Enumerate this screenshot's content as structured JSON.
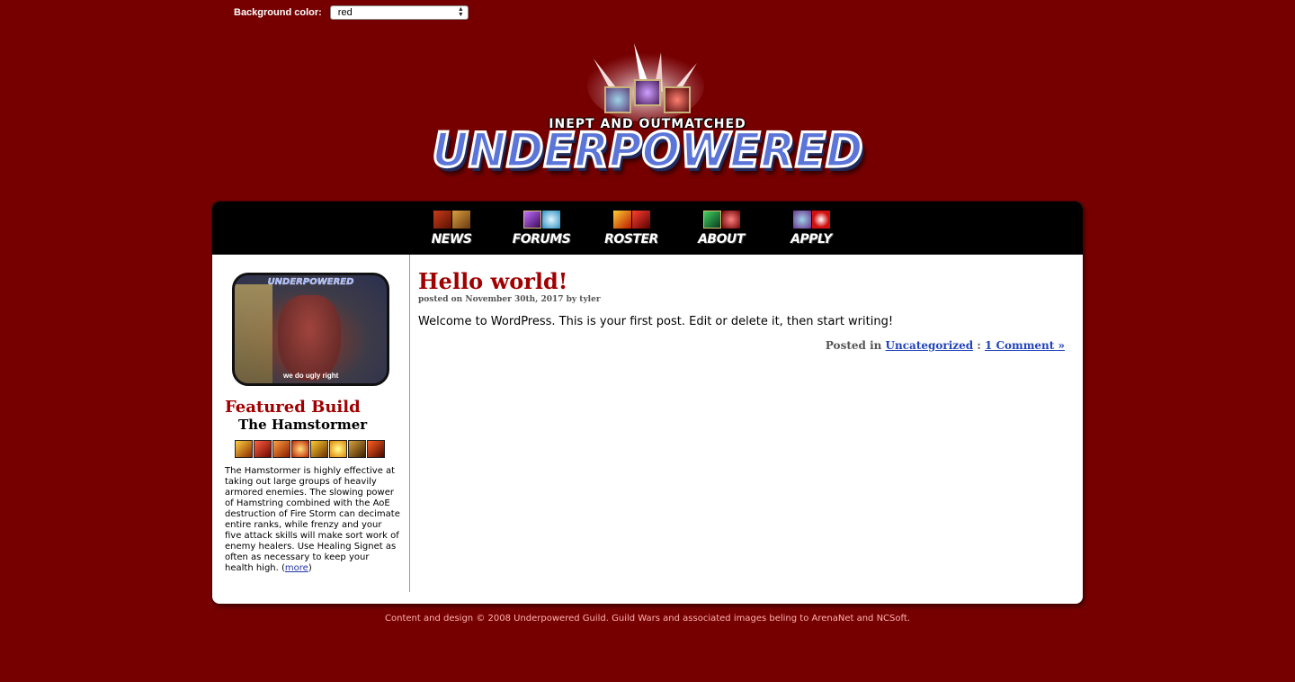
{
  "background_selector": {
    "label": "Background color:",
    "value": "red"
  },
  "logo": {
    "tagline": "INEPT AND OUTMATCHED",
    "wordmark": "UNDERPOWERED"
  },
  "nav": [
    {
      "label": "NEWS"
    },
    {
      "label": "FORUMS"
    },
    {
      "label": "ROSTER"
    },
    {
      "label": "ABOUT"
    },
    {
      "label": "APPLY"
    }
  ],
  "sidebar": {
    "portrait_brand": "UNDERPOWERED",
    "portrait_caption": "we do ugly right",
    "featured_title": "Featured Build",
    "build_name": "The Hamstormer",
    "description": "The Hamstormer is highly effective at taking out large groups of heavily armored enemies. The slowing power of Hamstring combined with the AoE destruction of Fire Storm can decimate entire ranks, while frenzy and your five attack skills will make sort work of enemy healers. Use Healing Signet as often as necessary to keep your health high.",
    "more_label": "more"
  },
  "post": {
    "title": "Hello world!",
    "meta": "posted on November 30th, 2017 by tyler",
    "body": "Welcome to WordPress. This is your first post. Edit or delete it, then start writing!",
    "posted_in_label": "Posted in",
    "category": "Uncategorized",
    "separator": ":",
    "comments": "1 Comment »"
  },
  "footer": "Content and design © 2008 Underpowered Guild. Guild Wars and associated images beling to ArenaNet and NCSoft.",
  "colors": {
    "page_bg": "#760000",
    "title_red": "#a00000",
    "nav_bg": "#000000",
    "link_blue": "#2244bb"
  }
}
